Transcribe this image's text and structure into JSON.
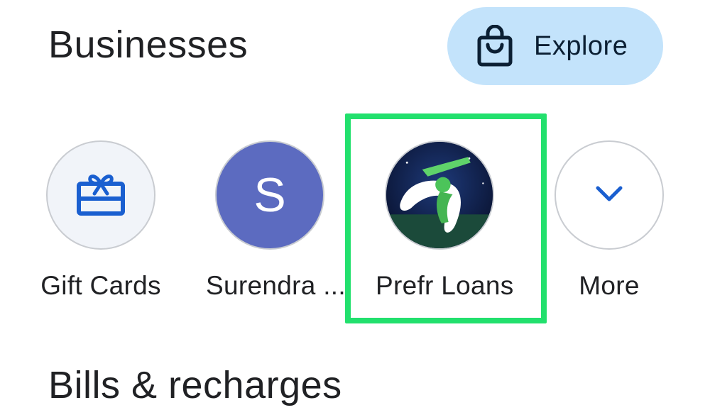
{
  "businesses": {
    "title": "Businesses",
    "explore_button": {
      "label": "Explore",
      "icon": "shopping-bag-icon"
    },
    "tiles": [
      {
        "label": "Gift Cards",
        "icon": "gift-card-icon"
      },
      {
        "label": "Surendra ...",
        "avatar_letter": "S"
      },
      {
        "label": "Prefr Loans",
        "icon": "cricket-player-logo"
      },
      {
        "label": "More",
        "icon": "chevron-down-icon"
      }
    ]
  },
  "bills": {
    "title": "Bills & recharges"
  },
  "colors": {
    "explore_bg": "#c3e3fb",
    "accent_blue": "#1a5fd0",
    "avatar_bg": "#5c6bc0",
    "highlight": "#22e06d"
  }
}
